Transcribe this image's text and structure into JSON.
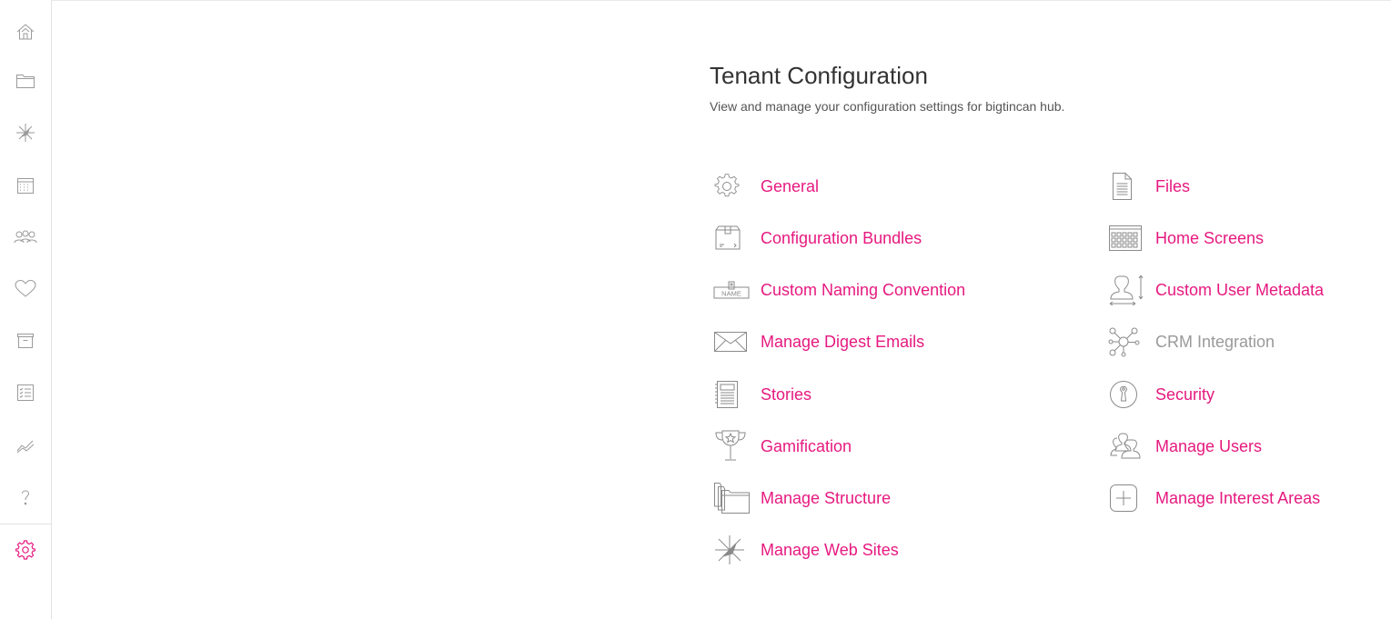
{
  "sidebar": {
    "items": [
      {
        "icon": "home-icon"
      },
      {
        "icon": "folder-icon"
      },
      {
        "icon": "compass-icon"
      },
      {
        "icon": "calendar-icon"
      },
      {
        "icon": "people-icon"
      },
      {
        "icon": "heart-icon"
      },
      {
        "icon": "archive-icon"
      },
      {
        "icon": "checklist-icon"
      },
      {
        "icon": "analytics-icon"
      },
      {
        "icon": "help-icon"
      },
      {
        "icon": "gear-icon",
        "active": true
      }
    ],
    "active_color": "#e6197f"
  },
  "header": {
    "title": "Tenant Configuration",
    "subtitle": "View and manage your configuration settings for bigtincan hub."
  },
  "config": {
    "left": [
      {
        "label": "General",
        "icon": "gear-icon"
      },
      {
        "label": "Configuration Bundles",
        "icon": "box-icon"
      },
      {
        "label": "Custom Naming Convention",
        "icon": "name-tag-icon"
      },
      {
        "label": "Manage Digest Emails",
        "icon": "envelope-icon"
      },
      {
        "label": "Stories",
        "icon": "stories-icon"
      },
      {
        "label": "Gamification",
        "icon": "trophy-icon"
      },
      {
        "label": "Manage Structure",
        "icon": "folders-icon"
      },
      {
        "label": "Manage Web Sites",
        "icon": "compass-icon"
      }
    ],
    "right": [
      {
        "label": "Files",
        "icon": "document-icon"
      },
      {
        "label": "Home Screens",
        "icon": "grid-icon"
      },
      {
        "label": "Custom User Metadata",
        "icon": "user-metadata-icon"
      },
      {
        "label": "CRM Integration",
        "icon": "network-icon",
        "disabled": true
      },
      {
        "label": "Security",
        "icon": "lock-icon"
      },
      {
        "label": "Manage Users",
        "icon": "users-icon"
      },
      {
        "label": "Manage Interest Areas",
        "icon": "plus-box-icon"
      }
    ]
  },
  "colors": {
    "accent": "#e6197f",
    "icon_gray": "#9a9a9a",
    "title": "#333333"
  }
}
